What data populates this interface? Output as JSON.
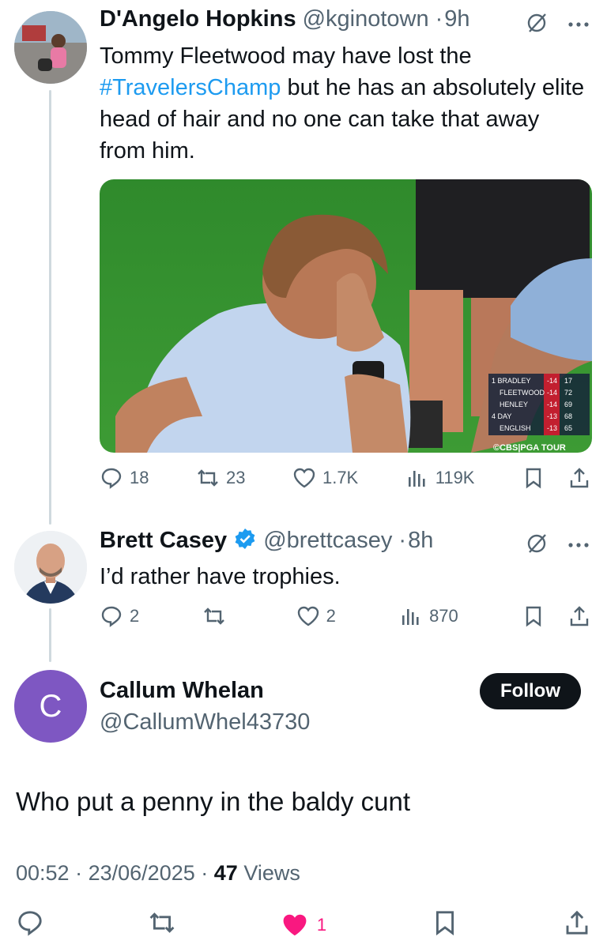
{
  "tweet1": {
    "name": "D'Angelo Hopkins",
    "handle": "@kginotown",
    "time": "9h",
    "text_before": "Tommy Fleetwood may have lost the ",
    "hashtag": "#TravelersChamp",
    "text_after": " but he has an absolutely elite head of hair and no one can take that away from him.",
    "media": {
      "leaderboard": [
        {
          "pos": "1",
          "player": "BRADLEY",
          "score": "-14",
          "round": "17"
        },
        {
          "pos": "",
          "player": "FLEETWOOD",
          "score": "-14",
          "round": "72"
        },
        {
          "pos": "",
          "player": "HENLEY",
          "score": "-14",
          "round": "69"
        },
        {
          "pos": "4",
          "player": "DAY",
          "score": "-13",
          "round": "68"
        },
        {
          "pos": "",
          "player": "ENGLISH",
          "score": "-13",
          "round": "65"
        }
      ],
      "watermark": "©CBS|PGA TOUR"
    },
    "stats": {
      "replies": "18",
      "reposts": "23",
      "likes": "1.7K",
      "views": "119K"
    }
  },
  "tweet2": {
    "name": "Brett Casey",
    "handle": "@brettcasey",
    "time": "8h",
    "text": "I’d rather have trophies.",
    "stats": {
      "replies": "2",
      "reposts": "",
      "likes": "2",
      "views": "870"
    }
  },
  "main": {
    "avatar_letter": "C",
    "name": "Callum Whelan",
    "handle": "@CallumWhel43730",
    "follow_label": "Follow",
    "text": "Who put a penny in the baldy cunt",
    "time": "00:52",
    "date": "23/06/2025",
    "views_count": "47",
    "views_label": "Views",
    "likes": "1"
  },
  "colors": {
    "accent": "#1d9bf0",
    "like_active": "#f91880",
    "muted": "#536471",
    "avatar_purple": "#7e57c2"
  }
}
